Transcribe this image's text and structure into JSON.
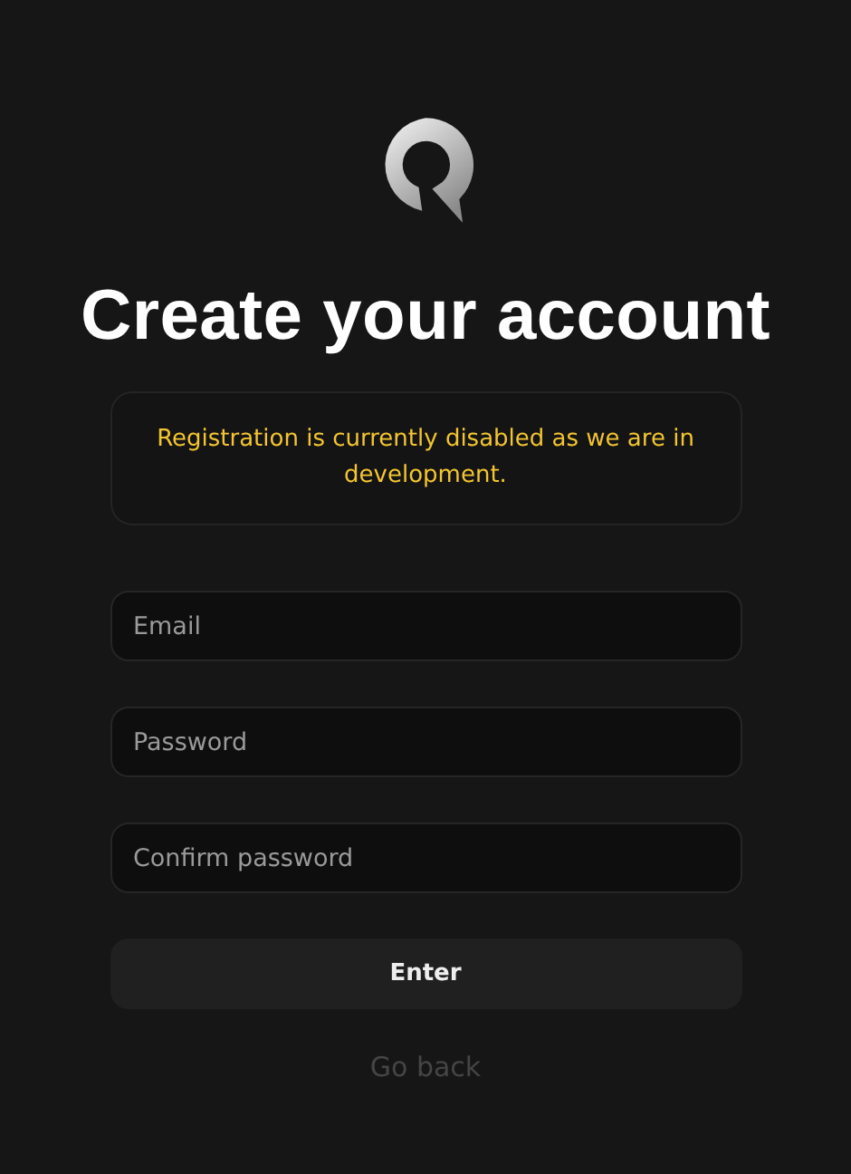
{
  "title": "Create your account",
  "notice": "Registration is currently disabled as we are in development.",
  "fields": [
    {
      "placeholder": "Email"
    },
    {
      "placeholder": "Password"
    },
    {
      "placeholder": "Confirm password"
    }
  ],
  "submit": "Enter",
  "back_link": "Go back"
}
